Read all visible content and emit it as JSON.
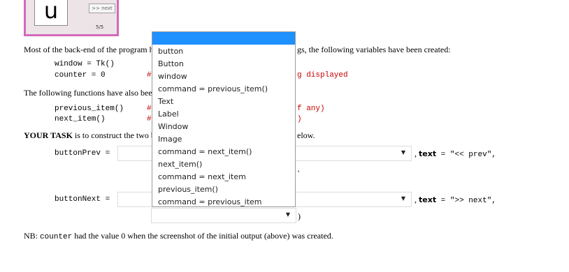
{
  "preview": {
    "letter": "u",
    "next_label": ">> next",
    "counter": "5/5"
  },
  "text": {
    "p1_start": "Most of the back-end of the program ha",
    "p1_end": "gs, the following variables have been created:",
    "code_window": "window = Tk()",
    "code_counter": "counter = 0",
    "comment_counter_hash": "#",
    "comment_counter_tail": "g displayed",
    "p2_start": "The following functions have also been",
    "code_prev": "previous_item()",
    "code_next": "next_item()",
    "comment_prev_hash": "#",
    "comment_prev_tail": "f any)",
    "comment_next_hash": "#",
    "comment_next_tail": ")",
    "task_bold": "YOUR TASK",
    "task_start": " is to construct the two b",
    "task_end": "elow.",
    "button_prev_label": "buttonPrev =",
    "prev_text_kw": "text",
    "prev_text_val": " = \"<< prev\",",
    "prev_comma": ",",
    "prev_quote_mark": "'",
    "button_next_label": "buttonNext =",
    "next_text_kw": "text",
    "next_text_val": " = \">> next\",",
    "next_comma": ",",
    "close_paren": ")",
    "nb_prefix": "NB: ",
    "nb_code": "counter",
    "nb_suffix": " had the value 0 when the screenshot of the initial output (above) was created."
  },
  "dropdown": {
    "options": [
      "button",
      "Button",
      "window",
      "command = previous_item()",
      "Text",
      "Label",
      "Window",
      "Image",
      "command = next_item()",
      "next_item()",
      "command = next_item",
      "previous_item()",
      "command = previous_item"
    ]
  },
  "colors": {
    "highlight": "#1e90ff",
    "preview_border": "#d36ab8",
    "comment": "#cc0000"
  }
}
